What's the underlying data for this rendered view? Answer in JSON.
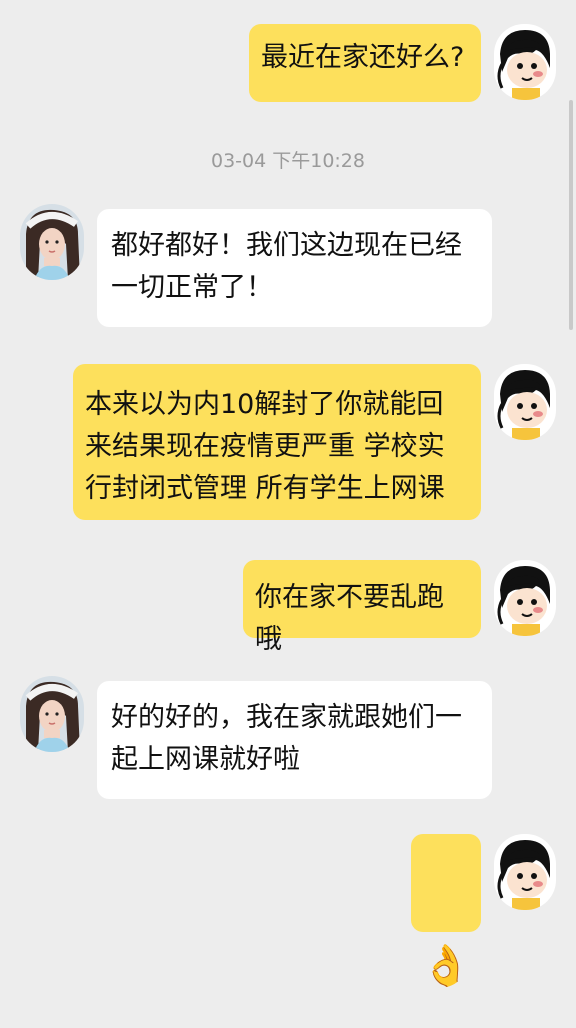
{
  "conversation": {
    "messages": [
      {
        "side": "me",
        "text": "最近在家还好么?"
      },
      {
        "side": "timestamp",
        "text": "03-04 下午10:28"
      },
      {
        "side": "other",
        "text": "都好都好！我们这边现在已经一切正常了！"
      },
      {
        "side": "me",
        "text": "本来以为内10解封了你就能回来结果现在疫情更严重 学校实行封闭式管理 所有学生上网课"
      },
      {
        "side": "me",
        "text": "你在家不要乱跑哦"
      },
      {
        "side": "other",
        "text": "好的好的，我在家就跟她们一起上网课就好啦"
      },
      {
        "side": "me",
        "emoji": "👌"
      }
    ]
  },
  "colors": {
    "background": "#ededed",
    "my_bubble": "#fde05c",
    "other_bubble": "#ffffff"
  },
  "icons": {
    "my_avatar": "cartoon-girl-avatar",
    "other_avatar": "girl-photo-avatar"
  }
}
